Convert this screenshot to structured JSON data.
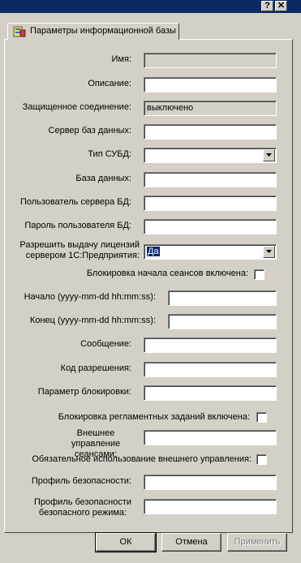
{
  "titlebar": {
    "help_label": "?",
    "close_label": "✕"
  },
  "tab": {
    "label": "Параметры информационной базы",
    "icon": "infobase-icon"
  },
  "fields": {
    "name": {
      "label": "Имя:",
      "value": ""
    },
    "description": {
      "label": "Описание:",
      "value": ""
    },
    "secure_connection": {
      "label": "Защищенное соединение:",
      "value": "выключено"
    },
    "db_server": {
      "label": "Сервер баз данных:",
      "value": ""
    },
    "dbms_type": {
      "label": "Тип СУБД:",
      "value": ""
    },
    "database": {
      "label": "База данных:",
      "value": ""
    },
    "db_user": {
      "label": "Пользователь сервера БД:",
      "value": ""
    },
    "db_password": {
      "label": "Пароль пользователя БД:",
      "value": ""
    },
    "licenses": {
      "label": "Разрешить выдачу лицензий сервером 1С:Предприятия:",
      "value": "Да"
    },
    "session_lock": {
      "label": "Блокировка начала сеансов включена:",
      "checked": false
    },
    "lock_start": {
      "label": "Начало (yyyy-mm-dd hh:mm:ss):",
      "value": ""
    },
    "lock_end": {
      "label": "Конец (yyyy-mm-dd hh:mm:ss):",
      "value": ""
    },
    "message": {
      "label": "Сообщение:",
      "value": ""
    },
    "permission_code": {
      "label": "Код разрешения:",
      "value": ""
    },
    "lock_param": {
      "label": "Параметр блокировки:",
      "value": ""
    },
    "scheduled_lock": {
      "label": "Блокировка регламентных заданий включена:",
      "checked": false
    },
    "ext_session_mgmt": {
      "label": "Внешнее управление сеансами:",
      "value": ""
    },
    "ext_mgmt_required": {
      "label": "Обязательное использование внешнего управления:",
      "checked": false
    },
    "security_profile": {
      "label": "Профиль безопасности:",
      "value": ""
    },
    "safe_mode_profile": {
      "label": "Профиль безопасности безопасного режима:",
      "value": ""
    }
  },
  "buttons": {
    "ok": "ОК",
    "cancel": "Отмена",
    "apply": "Применить"
  },
  "colors": {
    "face": "#d4d0c8",
    "titlebar": "#0b2a63",
    "selection": "#0a246a"
  }
}
